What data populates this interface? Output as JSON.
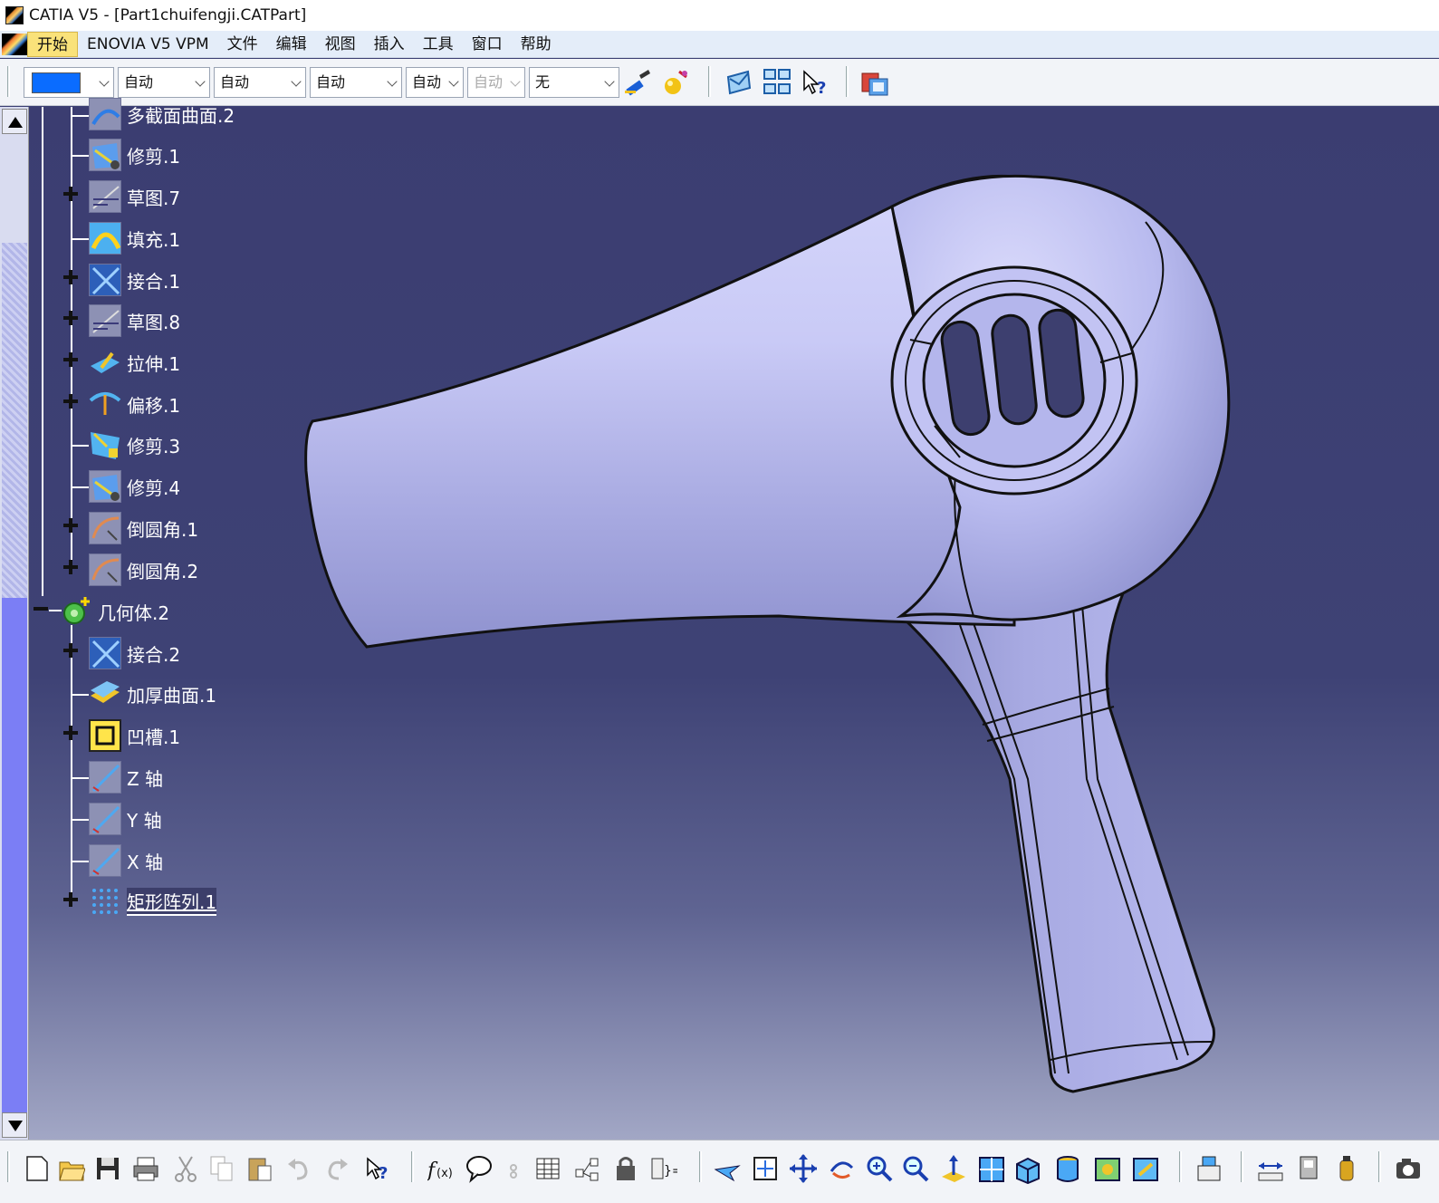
{
  "window": {
    "title": "CATIA V5 - [Part1chuifengji.CATPart]"
  },
  "menu": {
    "items": [
      "开始",
      "ENOVIA V5 VPM",
      "文件",
      "编辑",
      "视图",
      "插入",
      "工具",
      "窗口",
      "帮助"
    ],
    "active_index": 0
  },
  "top_toolbar": {
    "color_combo": {
      "value": "",
      "swatch_color": "#0a6cff"
    },
    "combos": [
      {
        "value": "自动"
      },
      {
        "value": "自动"
      },
      {
        "value": "自动"
      },
      {
        "value": "自动"
      },
      {
        "value": "自动",
        "disabled": true
      },
      {
        "value": "无"
      }
    ],
    "icons": [
      "painter-icon",
      "apply-material-icon",
      "reset-icon",
      "selection-sets-icon",
      "whats-this-icon",
      "catalog-icon"
    ]
  },
  "tree": {
    "nodes": [
      {
        "label": "多截面曲面.2",
        "icon": "multisection-surface-icon",
        "expander": "none"
      },
      {
        "label": "修剪.1",
        "icon": "trim-icon",
        "expander": "none"
      },
      {
        "label": "草图.7",
        "icon": "sketch-icon",
        "expander": "plus"
      },
      {
        "label": "填充.1",
        "icon": "fill-icon",
        "expander": "none"
      },
      {
        "label": "接合.1",
        "icon": "join-icon",
        "expander": "plus"
      },
      {
        "label": "草图.8",
        "icon": "sketch-icon",
        "expander": "plus"
      },
      {
        "label": "拉伸.1",
        "icon": "extrude-icon",
        "expander": "plus"
      },
      {
        "label": "偏移.1",
        "icon": "offset-icon",
        "expander": "plus"
      },
      {
        "label": "修剪.3",
        "icon": "trim-icon",
        "expander": "none"
      },
      {
        "label": "修剪.4",
        "icon": "trim-icon",
        "expander": "none"
      },
      {
        "label": "倒圆角.1",
        "icon": "fillet-icon",
        "expander": "plus"
      },
      {
        "label": "倒圆角.2",
        "icon": "fillet-icon",
        "expander": "plus"
      },
      {
        "label": "几何体.2",
        "icon": "body-icon",
        "expander": "minus"
      },
      {
        "label": "接合.2",
        "icon": "join-icon",
        "expander": "plus"
      },
      {
        "label": "加厚曲面.1",
        "icon": "thick-surface-icon",
        "expander": "none"
      },
      {
        "label": "凹槽.1",
        "icon": "pocket-icon",
        "expander": "plus"
      },
      {
        "label": "Z 轴",
        "icon": "axis-icon",
        "expander": "none"
      },
      {
        "label": "Y 轴",
        "icon": "axis-icon",
        "expander": "none"
      },
      {
        "label": "X 轴",
        "icon": "axis-icon",
        "expander": "none"
      },
      {
        "label": "矩形阵列.1",
        "icon": "rectangular-pattern-icon",
        "expander": "plus",
        "selected": true
      }
    ]
  },
  "viewport": {
    "model": "hair-dryer-3d-model",
    "model_color": "#b9bbef",
    "background_top": "#3b3d71",
    "background_bottom": "#a2a7c5"
  },
  "bottom_toolbar": {
    "icons": [
      "new-icon",
      "open-icon",
      "save-icon",
      "print-icon",
      "cut-icon",
      "copy-icon",
      "paste-icon",
      "undo-icon",
      "redo-icon",
      "whats-this-icon",
      "formula-icon",
      "knowledge-advisor-icon",
      "ordered-set-icon",
      "design-table-icon",
      "reorder-icon",
      "lock-icon",
      "law-icon",
      "fly-mode-icon",
      "fit-all-icon",
      "pan-icon",
      "rotate-icon",
      "zoom-in-icon",
      "zoom-out-icon",
      "normal-view-icon",
      "multi-view-icon",
      "isometric-view-icon",
      "shading-icon",
      "hide-show-icon",
      "swap-visible-space-icon",
      "tools-palette-icon",
      "measure-icon",
      "inertia-icon",
      "apply-material-bottom-icon",
      "capture-icon"
    ]
  }
}
